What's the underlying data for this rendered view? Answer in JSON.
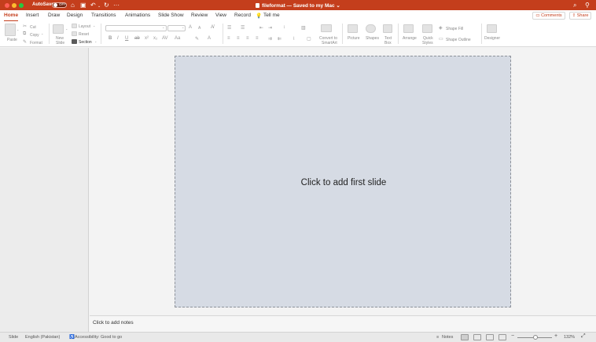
{
  "titlebar": {
    "autosave_label": "AutoSave",
    "autosave_state": "OFF",
    "document_title": "fileformat — Saved to my Mac ⌄"
  },
  "tabs": [
    "Home",
    "Insert",
    "Draw",
    "Design",
    "Transitions",
    "Animations",
    "Slide Show",
    "Review",
    "View",
    "Record"
  ],
  "tell_me": "Tell me",
  "actions": {
    "comments": "Comments",
    "share": "Share"
  },
  "ribbon": {
    "paste": "Paste",
    "cut": "Cut",
    "copy": "Copy",
    "format": "Format",
    "new_slide_1": "New",
    "new_slide_2": "Slide",
    "layout": "Layout",
    "reset": "Reset",
    "section": "Section",
    "convert_1": "Convert to",
    "convert_2": "SmartArt",
    "picture": "Picture",
    "shapes": "Shapes",
    "textbox_1": "Text",
    "textbox_2": "Box",
    "arrange": "Arrange",
    "quick_styles_1": "Quick",
    "quick_styles_2": "Styles",
    "shape_fill": "Shape Fill",
    "shape_outline": "Shape Outline",
    "designer": "Designer"
  },
  "slide": {
    "placeholder": "Click to add first slide"
  },
  "notes": {
    "placeholder": "Click to add notes"
  },
  "statusbar": {
    "slide": "Slide",
    "language": "English (Pakistan)",
    "accessibility": "Accessibility: Good to go",
    "notes": "Notes",
    "zoom": "132%"
  },
  "colors": {
    "accent": "#c43e1c",
    "slide_bg": "#d6dbe4"
  }
}
